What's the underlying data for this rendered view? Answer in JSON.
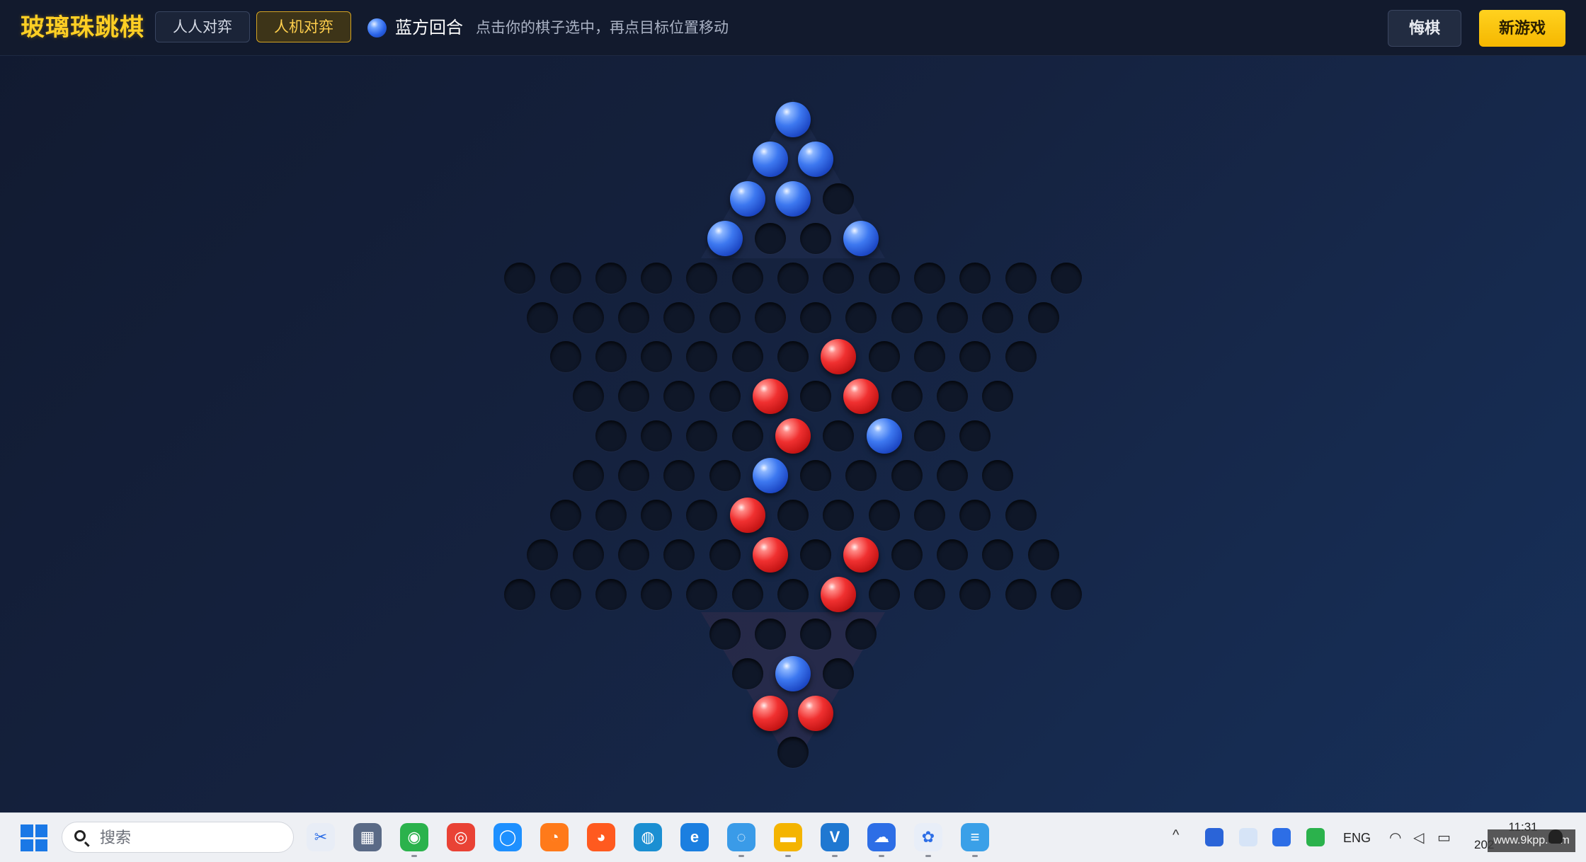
{
  "header": {
    "logo": "玻璃珠跳棋",
    "modes": [
      {
        "label": "人人对弈",
        "active": false
      },
      {
        "label": "人机对弈",
        "active": true
      }
    ],
    "turn_label": "蓝方回合",
    "turn_color": "blue",
    "hint": "点击你的棋子选中，再点目标位置移动",
    "undo_label": "悔棋",
    "new_game_label": "新游戏"
  },
  "board": {
    "shape": "six-pointed star (two corner triangles shown)",
    "colors": {
      "blue": "#2f6ee8",
      "red": "#e52222",
      "empty": "#0f1728"
    },
    "rows": [
      "b",
      "bb",
      "bb.",
      "b..b",
      ".............",
      "............",
      "......r....",
      "....r.r...",
      "....r.b..",
      "....b.....",
      "....r......",
      ".....r.r....",
      ".......r.....",
      "....",
      ".b.",
      "rr",
      "."
    ]
  },
  "taskbar": {
    "search_placeholder": "搜索",
    "apps": [
      {
        "name": "snipping-tool",
        "color": "#e8edf6",
        "glyph": "✂"
      },
      {
        "name": "calculator",
        "color": "#5a6a86",
        "glyph": "▦"
      },
      {
        "name": "wechat",
        "color": "#2bb24c",
        "glyph": "◉"
      },
      {
        "name": "chrome",
        "color": "#e94235",
        "glyph": "◎"
      },
      {
        "name": "browser-blue",
        "color": "#1e90ff",
        "glyph": "◯"
      },
      {
        "name": "app-orange",
        "color": "#ff7a1a",
        "glyph": "◔"
      },
      {
        "name": "firefox",
        "color": "#ff5a1f",
        "glyph": "◕"
      },
      {
        "name": "edge",
        "color": "#1b8fd2",
        "glyph": "◍"
      },
      {
        "name": "ie",
        "color": "#1b7fe0",
        "glyph": "e"
      },
      {
        "name": "search-app",
        "color": "#3a9be8",
        "glyph": "◌"
      },
      {
        "name": "file-explorer",
        "color": "#f4b400",
        "glyph": "▬"
      },
      {
        "name": "vscode-like",
        "color": "#1f78d1",
        "glyph": "V"
      },
      {
        "name": "cloud-app",
        "color": "#2d6ee6",
        "glyph": "☁"
      },
      {
        "name": "photos-app",
        "color": "#e8eef8",
        "glyph": "✿"
      },
      {
        "name": "notepad",
        "color": "#3aa0e8",
        "glyph": "≡"
      }
    ],
    "tray": {
      "lang": "ENG",
      "time": "11:31",
      "date": "202",
      "watermark": "www.9kpp.com"
    }
  }
}
